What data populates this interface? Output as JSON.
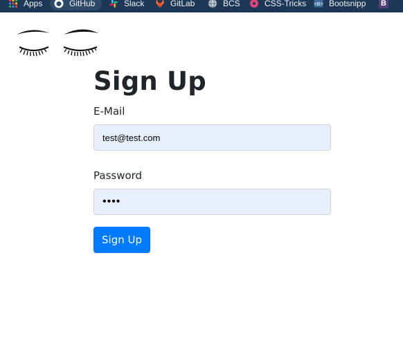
{
  "bookmarks": [
    {
      "label": "Apps",
      "icon": "apps-grid-icon",
      "color": "#f28b82"
    },
    {
      "label": "GitHub",
      "icon": "github-icon",
      "color": "#ffffff"
    },
    {
      "label": "Slack",
      "icon": "slack-icon",
      "color": "#e01e5a"
    },
    {
      "label": "GitLab",
      "icon": "gitlab-icon",
      "color": "#fc6d26"
    },
    {
      "label": "BCS",
      "icon": "globe-icon",
      "color": "#c9d3de"
    },
    {
      "label": "CSS-Tricks",
      "icon": "css-tricks-icon",
      "color": "#e0457b"
    },
    {
      "label": "Bootsnipp",
      "icon": "bootsnipp-icon",
      "color": "#3e6d9c"
    },
    {
      "label": "B",
      "icon": "bootstrap-icon",
      "color": "#563d7c"
    }
  ],
  "signup": {
    "title": "Sign Up",
    "email_label": "E-Mail",
    "email_value": "test@test.com",
    "password_label": "Password",
    "password_value": "test",
    "submit_label": "Sign Up"
  },
  "colors": {
    "primary": "#007bff",
    "autofill_bg": "#e8f0fe",
    "text": "#212529",
    "bookmarks_bg": "#1d3857"
  }
}
